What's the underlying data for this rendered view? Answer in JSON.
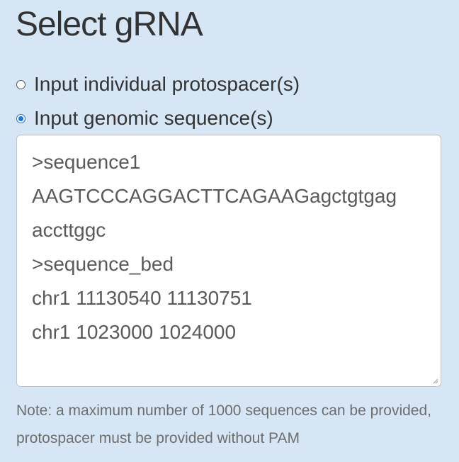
{
  "title": "Select gRNA",
  "input_mode": {
    "options": [
      {
        "label": "Input individual protospacer(s)",
        "selected": false
      },
      {
        "label": "Input genomic sequence(s)",
        "selected": true
      }
    ]
  },
  "sequence_input": {
    "lines": [
      ">sequence1",
      "AAGTCCCAGGACTTCAGAAGagctgtgag",
      "accttggc",
      ">sequence_bed",
      "chr1 11130540 11130751",
      "chr1 1023000 1024000"
    ]
  },
  "note": "Note: a maximum number of 1000 sequences can be provided, protospacer must be provided without PAM",
  "colors": {
    "background": "#d6e6f4",
    "accent": "#1a73d9"
  }
}
